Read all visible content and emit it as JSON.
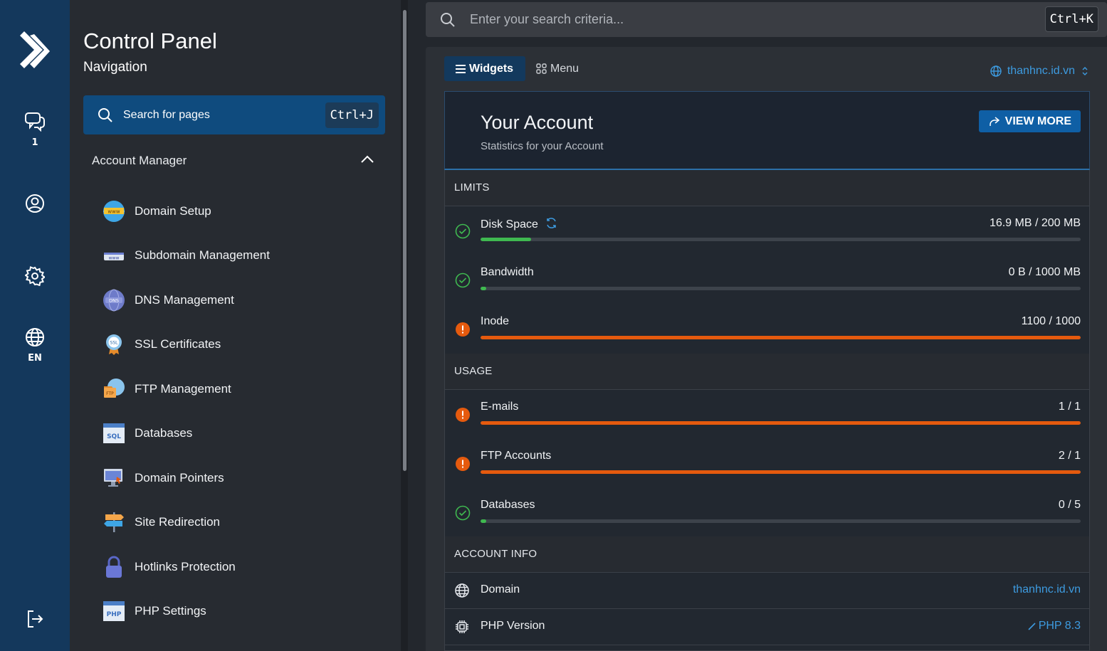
{
  "rail": {
    "chat_badge": "1",
    "language": "EN"
  },
  "sidebar": {
    "title": "Control Panel",
    "subtitle": "Navigation",
    "search_label": "Search for pages",
    "search_shortcut": "Ctrl+J",
    "section": "Account Manager",
    "items": [
      {
        "label": "Domain Setup",
        "icon": "domain-setup-icon"
      },
      {
        "label": "Subdomain Management",
        "icon": "subdomain-icon"
      },
      {
        "label": "DNS Management",
        "icon": "dns-icon"
      },
      {
        "label": "SSL Certificates",
        "icon": "ssl-icon"
      },
      {
        "label": "FTP Management",
        "icon": "ftp-icon"
      },
      {
        "label": "Databases",
        "icon": "sql-icon"
      },
      {
        "label": "Domain Pointers",
        "icon": "domain-pointers-icon"
      },
      {
        "label": "Site Redirection",
        "icon": "signpost-icon"
      },
      {
        "label": "Hotlinks Protection",
        "icon": "lock-icon"
      },
      {
        "label": "PHP Settings",
        "icon": "php-icon"
      }
    ]
  },
  "topsearch": {
    "placeholder": "Enter your search criteria...",
    "shortcut": "Ctrl+K"
  },
  "main": {
    "tab_widgets": "Widgets",
    "tab_menu": "Menu",
    "domain_select": "thanhnc.id.vn",
    "account": {
      "title": "Your Account",
      "subtitle": "Statistics for your Account",
      "view_more": "VIEW MORE"
    },
    "limits_header": "LIMITS",
    "limits": [
      {
        "label": "Disk Space",
        "value": "16.9 MB / 200 MB",
        "fraction": 0.0845,
        "status": "ok"
      },
      {
        "label": "Bandwidth",
        "value": "0 B / 1000 MB",
        "fraction": 0,
        "status": "ok"
      },
      {
        "label": "Inode",
        "value": "1100 / 1000",
        "fraction": 1,
        "status": "warn"
      }
    ],
    "usage_header": "USAGE",
    "usage": [
      {
        "label": "E-mails",
        "value": "1 / 1",
        "fraction": 1,
        "status": "warn"
      },
      {
        "label": "FTP Accounts",
        "value": "2 / 1",
        "fraction": 1,
        "status": "warn"
      },
      {
        "label": "Databases",
        "value": "0 / 5",
        "fraction": 0,
        "status": "ok"
      }
    ],
    "info_header": "ACCOUNT INFO",
    "info": [
      {
        "label": "Domain",
        "value": "thanhnc.id.vn"
      },
      {
        "label": "PHP Version",
        "value": "PHP 8.3"
      }
    ]
  },
  "colors": {
    "ok": "#3fb950",
    "warn": "#e55a0e",
    "accent": "#3d9be0",
    "rail": "#14385c"
  }
}
